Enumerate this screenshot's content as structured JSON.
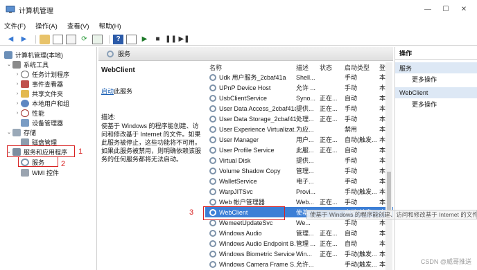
{
  "window": {
    "title": "计算机管理"
  },
  "menu": [
    "文件(F)",
    "操作(A)",
    "查看(V)",
    "帮助(H)"
  ],
  "tree": {
    "root": "计算机管理(本地)",
    "system_tools": "系统工具",
    "task_scheduler": "任务计划程序",
    "event_viewer": "事件查看器",
    "shared_folders": "共享文件夹",
    "local_users": "本地用户和组",
    "performance": "性能",
    "device_manager": "设备管理器",
    "storage": "存储",
    "disk_management": "磁盘管理",
    "services_apps": "服务和应用程序",
    "services": "服务",
    "wmi": "WMI 控件"
  },
  "callouts": {
    "one": "1",
    "two": "2",
    "three": "3"
  },
  "services_header": "服务",
  "detail": {
    "name": "WebClient",
    "start_link": "启动",
    "start_suffix": "此服务",
    "desc_label": "描述:",
    "desc_text": "使基于 Windows 的程序能创建、访问和修改基于 Internet 的文件。如果此服务被停止，这些功能将不可用。如果此服务被禁用，则明确依赖该服务的任何服务都将无法启动。"
  },
  "columns": {
    "name": "名称",
    "desc": "描述",
    "status": "状态",
    "startup": "启动类型",
    "logon": "登"
  },
  "services": [
    {
      "name": "Udk 用户服务_2cbaf41a",
      "desc": "Shell...",
      "status": "",
      "startup": "手动",
      "logon": "本"
    },
    {
      "name": "UPnP Device Host",
      "desc": "允许 ...",
      "status": "",
      "startup": "手动",
      "logon": "本"
    },
    {
      "name": "UsbClientService",
      "desc": "Syno...",
      "status": "正在...",
      "startup": "自动",
      "logon": "本"
    },
    {
      "name": "User Data Access_2cbaf41a",
      "desc": "提供...",
      "status": "正在...",
      "startup": "手动",
      "logon": "本"
    },
    {
      "name": "User Data Storage_2cbaf41a",
      "desc": "处理...",
      "status": "正在...",
      "startup": "手动",
      "logon": "本"
    },
    {
      "name": "User Experience Virtualizat...",
      "desc": "为应...",
      "status": "",
      "startup": "禁用",
      "logon": "本"
    },
    {
      "name": "User Manager",
      "desc": "用户...",
      "status": "正在...",
      "startup": "自动(触发...",
      "logon": "本"
    },
    {
      "name": "User Profile Service",
      "desc": "此服...",
      "status": "正在...",
      "startup": "自动",
      "logon": "本"
    },
    {
      "name": "Virtual Disk",
      "desc": "提供...",
      "status": "",
      "startup": "手动",
      "logon": "本"
    },
    {
      "name": "Volume Shadow Copy",
      "desc": "管理...",
      "status": "",
      "startup": "手动",
      "logon": "本"
    },
    {
      "name": "WalletService",
      "desc": "电子...",
      "status": "",
      "startup": "手动",
      "logon": "本"
    },
    {
      "name": "WarpJITSvc",
      "desc": "Provi...",
      "status": "",
      "startup": "手动(触发...",
      "logon": "本"
    },
    {
      "name": "Web 帐户管理器",
      "desc": "Web...",
      "status": "正在...",
      "startup": "手动",
      "logon": "本"
    },
    {
      "name": "WebClient",
      "desc": "使基...",
      "status": "",
      "startup": "自动(触发...",
      "logon": "本"
    },
    {
      "name": "WemeetUpdateSvc",
      "desc": "We...",
      "status": "",
      "startup": "手动",
      "logon": "本"
    },
    {
      "name": "Windows Audio",
      "desc": "管理...",
      "status": "正在...",
      "startup": "自动",
      "logon": "本"
    },
    {
      "name": "Windows Audio Endpoint B...",
      "desc": "管理 ...",
      "status": "正在...",
      "startup": "自动",
      "logon": "本"
    },
    {
      "name": "Windows Biometric Service",
      "desc": "Win...",
      "status": "正在...",
      "startup": "手动(触发...",
      "logon": "本"
    },
    {
      "name": "Windows Camera Frame S...",
      "desc": "允许...",
      "status": "",
      "startup": "手动(触发...",
      "logon": "本"
    }
  ],
  "tooltip": "使基于 Windows 的程序能创建、访问和修改基于 Internet 的文件。",
  "actions": {
    "title": "操作",
    "section1": "服务",
    "more1": "更多操作",
    "section2": "WebClient",
    "more2": "更多操作"
  },
  "watermark": "CSDN @威哥推送",
  "colors": {
    "accent_red": "#d82222",
    "selection": "#3c7fd6"
  }
}
